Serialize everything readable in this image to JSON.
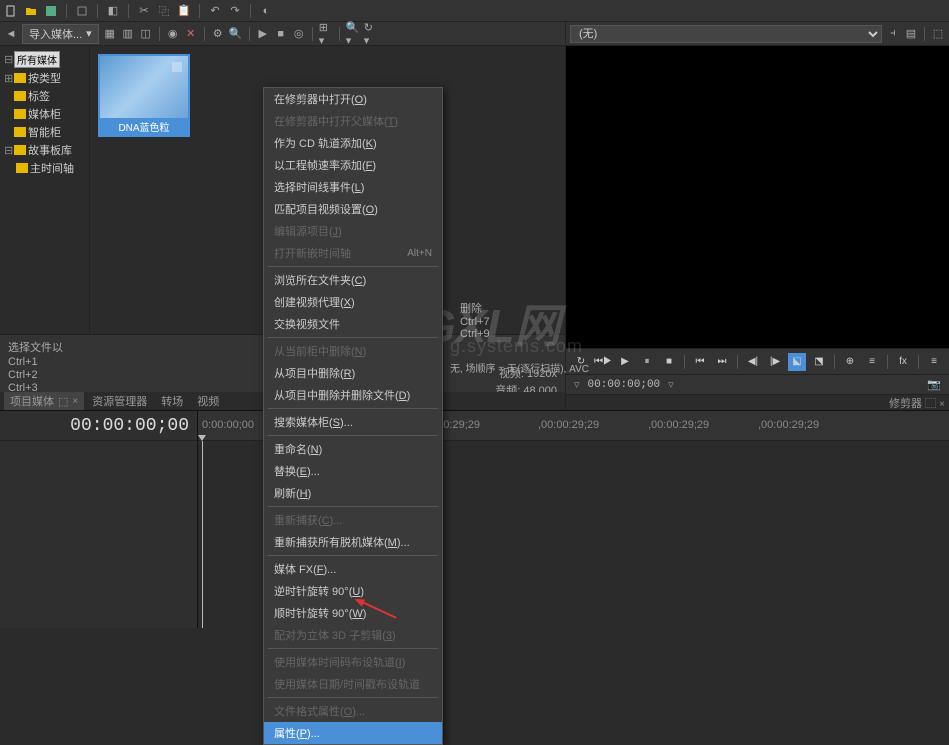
{
  "toolbar": {
    "import_label": "导入媒体..."
  },
  "tree": {
    "root": "所有媒体",
    "items": [
      "按类型",
      "标签",
      "媒体柜",
      "智能柜",
      "故事板库",
      "主时间轴"
    ]
  },
  "media": {
    "thumb_label": "DNA蓝色粒"
  },
  "info": {
    "select_label": "选择文件以",
    "shortcuts": [
      "Ctrl+1",
      "Ctrl+2",
      "Ctrl+3"
    ],
    "video_label": "视频: 1920x",
    "audio_label": "音频: 48,000",
    "scan_info": "无, 场顺序 = 无(逐行扫描), AVC",
    "del_col_title": "删除",
    "del_shortcuts": [
      "Ctrl+7",
      "Ctrl+9"
    ]
  },
  "tabs": {
    "t1": "项目媒体",
    "t2": "资源管理器",
    "t3": "转场",
    "t4": "视频"
  },
  "preview": {
    "select": "(无)",
    "trimmer_tab": "修剪器"
  },
  "transport": {
    "timecode": "00:00:00;00"
  },
  "timeline": {
    "timecode": "00:00:00;00",
    "marks": [
      "0:00:00;00",
      "0:00:29;29",
      ",00:00:29;29",
      ",00:00:29;29",
      ",00:00:29;29"
    ]
  },
  "context_menu": {
    "items": [
      {
        "label": "在修剪器中打开",
        "u": "O"
      },
      {
        "label": "在修剪器中打开父媒体",
        "u": "T",
        "disabled": true
      },
      {
        "label": "作为 CD 轨道添加",
        "u": "K"
      },
      {
        "label": "以工程帧速率添加",
        "u": "F"
      },
      {
        "label": "选择时间线事件",
        "u": "L"
      },
      {
        "label": "匹配项目视频设置",
        "u": "O"
      },
      {
        "label": "编辑源项目",
        "u": "J",
        "disabled": true
      },
      {
        "label": "打开新嵌时间轴",
        "shortcut": "Alt+N",
        "disabled": true
      },
      {
        "sep": true
      },
      {
        "label": "浏览所在文件夹",
        "u": "C"
      },
      {
        "label": "创建视频代理",
        "u": "X"
      },
      {
        "label": "交换视频文件"
      },
      {
        "sep": true
      },
      {
        "label": "从当前柜中删除",
        "u": "N",
        "disabled": true
      },
      {
        "label": "从项目中删除",
        "u": "R"
      },
      {
        "label": "从项目中删除并删除文件",
        "u": "D"
      },
      {
        "sep": true
      },
      {
        "label": "搜索媒体柜",
        "u": "S",
        "ellipsis": true
      },
      {
        "sep": true
      },
      {
        "label": "重命名",
        "u": "N"
      },
      {
        "label": "替换",
        "u": "E",
        "ellipsis": true
      },
      {
        "label": "刷新",
        "u": "H"
      },
      {
        "sep": true
      },
      {
        "label": "重新捕获",
        "u": "C",
        "ellipsis": true,
        "disabled": true
      },
      {
        "label": "重新捕获所有脱机媒体",
        "u": "M",
        "ellipsis": true
      },
      {
        "sep": true
      },
      {
        "label": "媒体 FX",
        "u": "F",
        "ellipsis": true
      },
      {
        "label": "逆时针旋转 90°",
        "u": "U"
      },
      {
        "label": "顺时针旋转 90°",
        "u": "W"
      },
      {
        "label": "配对为立体 3D 子剪辑",
        "u": "3",
        "disabled": true
      },
      {
        "sep": true
      },
      {
        "label": "使用媒体时间码布设轨道",
        "u": "I",
        "disabled": true
      },
      {
        "label": "使用媒体日期/时间戳布设轨道",
        "disabled": true
      },
      {
        "sep": true
      },
      {
        "label": "文件格式属性",
        "u": "O",
        "ellipsis": true,
        "disabled": true
      },
      {
        "label": "属性",
        "u": "P",
        "ellipsis": true,
        "highlight": true
      }
    ]
  }
}
